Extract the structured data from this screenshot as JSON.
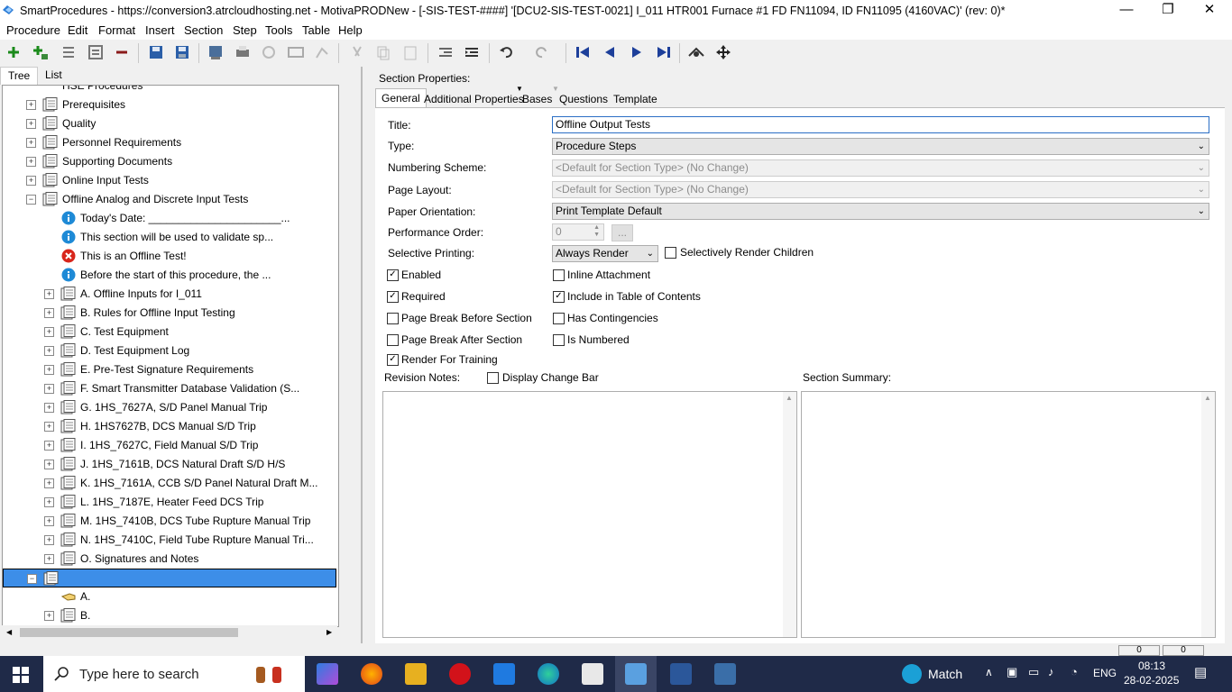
{
  "window": {
    "title": "SmartProcedures - https://conversion3.atrcloudhosting.net - MotivaPRODNew - [-SIS-TEST-####] '[DCU2-SIS-TEST-0021] I_011 HTR001 Furnace #1 FD FN11094, ID FN11095 (4160VAC)' (rev: 0)*",
    "minimize": "—",
    "restore": "❐",
    "close": "✕"
  },
  "menu": [
    "Procedure",
    "Edit",
    "Format",
    "Insert",
    "Section",
    "Step",
    "Tools",
    "Table",
    "Help"
  ],
  "left_tabs": [
    "Tree",
    "List"
  ],
  "tree": {
    "partial_top": "HSE Procedures",
    "items": [
      {
        "label": "Prerequisites",
        "type": "section"
      },
      {
        "label": "Quality",
        "type": "section"
      },
      {
        "label": "Personnel Requirements",
        "type": "section"
      },
      {
        "label": "Supporting Documents",
        "type": "section"
      },
      {
        "label": "Online Input Tests",
        "type": "section"
      },
      {
        "label": "Offline Analog and Discrete Input Tests",
        "type": "section-open"
      },
      {
        "label": "Today's Date: ______________________...",
        "type": "info"
      },
      {
        "label": "This section will be used to validate sp...",
        "type": "info"
      },
      {
        "label": "This is an Offline Test!",
        "type": "error"
      },
      {
        "label": "Before the start of this procedure, the ...",
        "type": "info"
      },
      {
        "label": "A. Offline Inputs for I_011",
        "type": "sub"
      },
      {
        "label": "B. Rules for Offline Input Testing",
        "type": "sub"
      },
      {
        "label": "C. Test Equipment",
        "type": "sub"
      },
      {
        "label": "D. Test Equipment Log",
        "type": "sub"
      },
      {
        "label": "E. Pre-Test Signature Requirements",
        "type": "sub"
      },
      {
        "label": "F. Smart Transmitter Database Validation (S...",
        "type": "sub"
      },
      {
        "label": "G. 1HS_7627A, S/D Panel Manual Trip",
        "type": "sub"
      },
      {
        "label": "H. 1HS7627B, DCS Manual S/D Trip",
        "type": "sub"
      },
      {
        "label": "I. 1HS_7627C, Field Manual S/D Trip",
        "type": "sub"
      },
      {
        "label": "J. 1HS_7161B, DCS Natural Draft S/D H/S",
        "type": "sub"
      },
      {
        "label": "K. 1HS_7161A, CCB S/D Panel Natural Draft M...",
        "type": "sub"
      },
      {
        "label": "L. 1HS_7187E, Heater Feed DCS Trip",
        "type": "sub"
      },
      {
        "label": "M. 1HS_7410B, DCS Tube Rupture Manual Trip",
        "type": "sub"
      },
      {
        "label": "N. 1HS_7410C, Field Tube Rupture Manual Tri...",
        "type": "sub"
      },
      {
        "label": "O. Signatures and Notes",
        "type": "sub"
      },
      {
        "label": "",
        "type": "selected"
      },
      {
        "label": "A.",
        "type": "hand"
      },
      {
        "label": "B.",
        "type": "sub"
      }
    ]
  },
  "section_properties": {
    "heading": "Section Properties:",
    "tabs": [
      "General",
      "Additional Properties",
      "Bases",
      "Questions",
      "Template"
    ],
    "labels": {
      "title": "Title:",
      "type": "Type:",
      "numbering": "Numbering Scheme:",
      "layout": "Page Layout:",
      "orientation": "Paper Orientation:",
      "perf_order": "Performance Order:",
      "selective": "Selective Printing:",
      "revision_notes": "Revision Notes:",
      "section_summary": "Section Summary:"
    },
    "values": {
      "title": "Offline Output Tests",
      "type": "Procedure Steps",
      "numbering": "<Default for Section Type> (No Change)",
      "layout": "<Default for Section Type> (No Change)",
      "orientation": "Print Template Default",
      "perf_order": "0",
      "selective": "Always Render",
      "ellipsis": "..."
    },
    "checkboxes": {
      "selectively_render_children": {
        "label": "Selectively Render Children",
        "checked": false
      },
      "enabled": {
        "label": "Enabled",
        "checked": true
      },
      "inline_attachment": {
        "label": "Inline Attachment",
        "checked": false
      },
      "required": {
        "label": "Required",
        "checked": true
      },
      "include_toc": {
        "label": "Include in Table of Contents",
        "checked": true
      },
      "page_break_before": {
        "label": "Page Break Before Section",
        "checked": false
      },
      "has_contingencies": {
        "label": "Has Contingencies",
        "checked": false
      },
      "page_break_after": {
        "label": "Page Break After Section",
        "checked": false
      },
      "is_numbered": {
        "label": "Is Numbered",
        "checked": false
      },
      "render_training": {
        "label": "Render For Training",
        "checked": true
      },
      "display_change_bar": {
        "label": "Display Change Bar",
        "checked": false
      }
    }
  },
  "statusbar": {
    "a": "0",
    "b": "0"
  },
  "taskbar": {
    "search_placeholder": "Type here to search",
    "match": "Match",
    "lang": "ENG",
    "time": "08:13",
    "date": "28-02-2025"
  }
}
